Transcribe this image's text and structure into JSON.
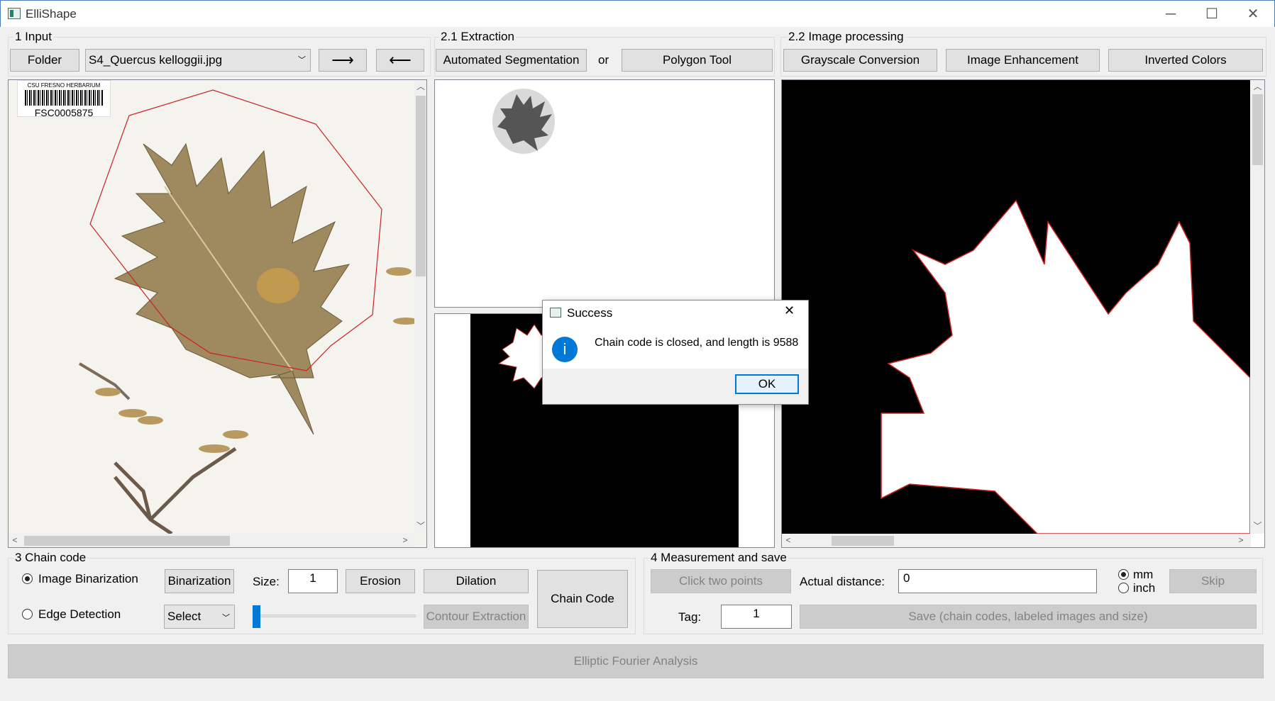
{
  "window": {
    "title": "ElliShape",
    "minimize": "─",
    "maximize": "☐",
    "close": "✕"
  },
  "input": {
    "group_label": "1 Input",
    "folder_button": "Folder",
    "file_select": "S4_Quercus kelloggii.jpg",
    "next_button": "⟶",
    "prev_button": "⟵",
    "barcode_org": "CSU FRESNO HERBARIUM",
    "barcode_id": "FSC0005875"
  },
  "extraction": {
    "group_label": "2.1 Extraction",
    "auto_button": "Automated Segmentation",
    "or_label": "or",
    "polygon_button": "Polygon Tool"
  },
  "processing": {
    "group_label": "2.2 Image processing",
    "grayscale_button": "Grayscale Conversion",
    "enhance_button": "Image Enhancement",
    "invert_button": "Inverted Colors"
  },
  "chain": {
    "group_label": "3 Chain code",
    "binarization_radio": "Image Binarization",
    "binarization_selected": true,
    "edge_radio": "Edge Detection",
    "binarization_button": "Binarization",
    "size_label": "Size:",
    "size_value": "1",
    "erosion_button": "Erosion",
    "dilation_button": "Dilation",
    "select_value": "Select",
    "contour_button": "Contour Extraction",
    "chain_code_button": "Chain Code",
    "slider_value": 0
  },
  "measure": {
    "group_label": "4 Measurement and save",
    "click_points_button": "Click two points",
    "actual_distance_label": "Actual distance:",
    "actual_distance_value": "0",
    "unit_mm": "mm",
    "unit_inch": "inch",
    "unit_selected": "mm",
    "skip_button": "Skip",
    "tag_label": "Tag:",
    "tag_value": "1",
    "save_button": "Save (chain codes, labeled images and size)"
  },
  "efa_button": "Elliptic Fourier Analysis",
  "dialog": {
    "title": "Success",
    "message": "Chain code is closed, and length is 9588",
    "ok_button": "OK",
    "info_icon_glyph": "i"
  },
  "colors": {
    "accent": "#0078d7",
    "outline": "#cc2222",
    "leaf": "#9e8a5e"
  }
}
